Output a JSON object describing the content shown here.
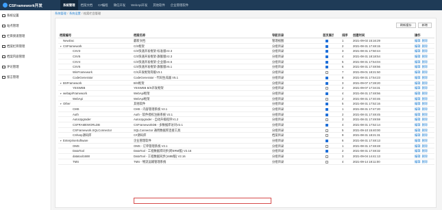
{
  "header": {
    "title": "CSFramework开发",
    "menus": [
      "系统管理",
      "档案文档",
      "C#编程",
      "微信开发",
      "WebApi开发",
      "其他软件",
      "企业管理软件"
    ],
    "active_menu": 0
  },
  "sidebar": {
    "items": [
      "系统设置",
      "站点管理",
      "栏目频道管理",
      "档案栏目管理",
      "档案内容管理",
      "评论管理",
      "留言管理"
    ]
  },
  "breadcrumb": {
    "root": "系统管理",
    "section": "系统设置",
    "current": "档案栏目管理"
  },
  "toolbar": {
    "refresh_label": "刷新缓存",
    "add_label": "新增"
  },
  "table": {
    "columns": [
      "档案编号",
      "档案名称",
      "导航目录",
      "首页展示",
      "排序",
      "创建时间",
      "操作"
    ],
    "edit_label": "编辑",
    "delete_label": "删除",
    "rows": [
      {
        "code": "NewDoc",
        "name": "最新文档",
        "nav": "管理视图",
        "show": true,
        "sort": "1",
        "created": "2021-09-02 15:16:29",
        "level": 0,
        "caret": ""
      },
      {
        "code": "CSFramework",
        "name": "C/S框架",
        "nav": "分组目录",
        "show": true,
        "sort": "2",
        "created": "2021-08-31 17:48:15",
        "level": 0,
        "caret": "▼"
      },
      {
        "code": "CSV3",
        "name": "C/S快速开发框架-标准版V2.3",
        "nav": "分组目录",
        "show": true,
        "sort": "3",
        "created": "2021-08-31 17:50:44",
        "level": 2,
        "caret": ""
      },
      {
        "code": "CSV5",
        "name": "C/S快速开发框架-旗舰版V2.3",
        "nav": "分组目录",
        "show": true,
        "sort": "4",
        "created": "2021-08-31 18:18:54",
        "level": 2,
        "caret": ""
      },
      {
        "code": "CSV4",
        "name": "C/S快速开发框架-企业版V4.5",
        "nav": "分组目录",
        "show": true,
        "sort": "5",
        "created": "2021-08-31 17:54:04",
        "level": 2,
        "caret": ""
      },
      {
        "code": "CSV5",
        "name": "C/S快速开发框架-旗舰版V5.1",
        "nav": "分组目录",
        "show": true,
        "sort": "6",
        "created": "2021-08-31 17:48:56",
        "level": 2,
        "caret": ""
      },
      {
        "code": "WinFramework",
        "name": "C/S开发框架简版V3.1",
        "nav": "分组目录",
        "show": false,
        "sort": "7",
        "created": "2021-09-01 18:21:50",
        "level": 2,
        "caret": ""
      },
      {
        "code": "CodeGenerator",
        "name": "CodeGenerator - 代码生成器 V5.1",
        "nav": "分组目录",
        "show": true,
        "sort": "8",
        "created": "2021-08-31 17:54:23",
        "level": 2,
        "caret": ""
      },
      {
        "code": "BSFramework",
        "name": "B/S框架",
        "nav": "分组目录",
        "show": true,
        "sort": "3",
        "created": "2021-09-07 17:28:20",
        "level": 0,
        "caret": "▼"
      },
      {
        "code": "YESWEB",
        "name": "YESWEB B/S开发框架",
        "nav": "分组目录",
        "show": false,
        "sort": "2",
        "created": "2021-09-07 17:34:31",
        "level": 2,
        "caret": ""
      },
      {
        "code": "webapiFramework",
        "name": "WebApi框架",
        "nav": "分组目录",
        "show": true,
        "sort": "4",
        "created": "2021-08-31 17:48:56",
        "level": 0,
        "caret": "▼"
      },
      {
        "code": "WebApi",
        "name": "WebApi框架",
        "nav": "分组目录",
        "show": false,
        "sort": "2",
        "created": "2021-08-31 17:40:46",
        "level": 2,
        "caret": ""
      },
      {
        "code": "Other",
        "name": "其他软件",
        "nav": "分组目录",
        "show": true,
        "sort": "5",
        "created": "2021-08-31 17:52:16",
        "level": 0,
        "caret": "▼"
      },
      {
        "code": "CMS",
        "name": "CMS - 内容管理系统 V2.1",
        "nav": "分组目录",
        "show": true,
        "sort": "1",
        "created": "2021-08-31 17:47:20",
        "level": 2,
        "caret": ""
      },
      {
        "code": "Auth",
        "name": "Auth - 软件授权注册系统 V2.1",
        "nav": "分组目录",
        "show": true,
        "sort": "2",
        "created": "2021-08-31 17:48:45",
        "level": 2,
        "caret": ""
      },
      {
        "code": "AutoUpgrader",
        "name": "AutoUpgrader - 自动升级程序V1.2",
        "nav": "分组目录",
        "show": false,
        "sort": "3",
        "created": "2021-08-31 17:49:59",
        "level": 2,
        "caret": ""
      },
      {
        "code": "CSFRAMEWORLDB",
        "name": "CSFrameworkDB - 多数据库访问V2.1",
        "nav": "分组目录",
        "show": true,
        "sort": "4",
        "created": "2021-08-31 17:52:14",
        "level": 2,
        "caret": ""
      },
      {
        "code": "CSFramework.SQLConnector",
        "name": "SQLConnector 通用数据库连接工具",
        "nav": "分组目录",
        "show": false,
        "sort": "5",
        "created": "2021-09-10 15:40:00",
        "level": 2,
        "caret": ""
      },
      {
        "code": "CSharp源码库",
        "name": "C#源码库",
        "nav": "档案目录",
        "show": false,
        "sort": "9",
        "created": "2021-08-31 18:21:31",
        "level": 2,
        "caret": ""
      },
      {
        "code": "EnterpriseSoftware",
        "name": "企业管理软件",
        "nav": "分组目录",
        "show": true,
        "sort": "6",
        "created": "2021-08-31 17:48:13",
        "level": 0,
        "caret": "▼"
      },
      {
        "code": "OMS",
        "name": "OMS - 订单管理系统 V2.1",
        "nav": "分组目录",
        "show": false,
        "sort": "1",
        "created": "2021-08-31 17:48:48",
        "level": 2,
        "caret": ""
      },
      {
        "code": "DataTool",
        "name": "DataTool - 工程数据库同步(跨ERM版) V2.16",
        "nav": "分组目录",
        "show": true,
        "sort": "2",
        "created": "2021-08-31 17:48:32",
        "level": 2,
        "caret": ""
      },
      {
        "code": "datatool1688",
        "name": "DataTool - 工程数据同步(1688版) V2.16",
        "nav": "分组目录",
        "show": false,
        "sort": "3",
        "created": "2021-09-04 14:41:13",
        "level": 2,
        "caret": ""
      },
      {
        "code": "TMS",
        "name": "TMS - 物流运输管理系统",
        "nav": "分组目录",
        "show": false,
        "sort": "4",
        "created": "2021-09-14 18:11:00",
        "level": 2,
        "caret": ""
      }
    ]
  }
}
